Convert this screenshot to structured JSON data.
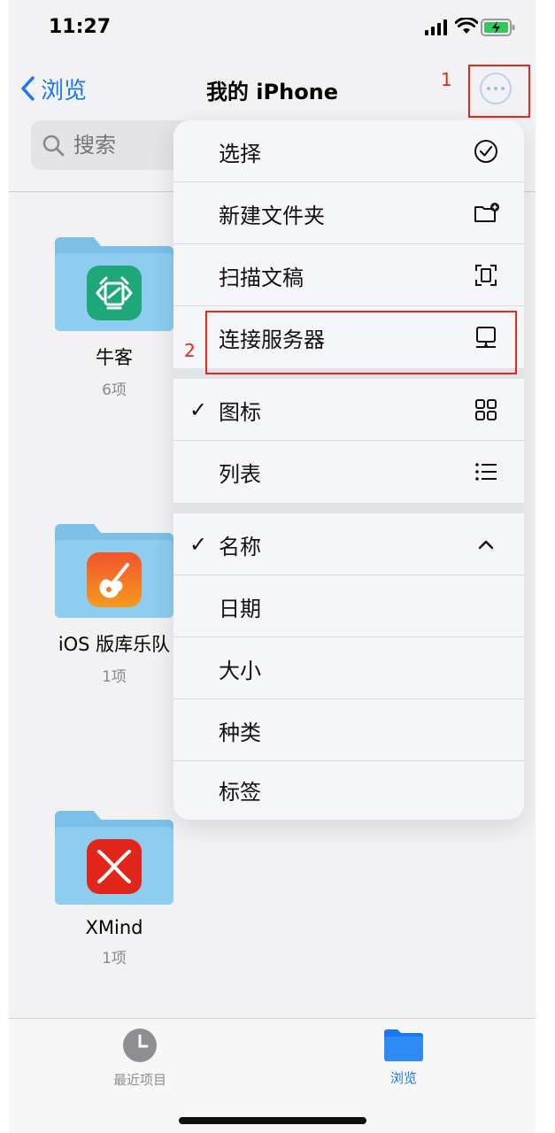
{
  "status": {
    "time": "11:27"
  },
  "nav": {
    "back_label": "浏览",
    "title": "我的 iPhone"
  },
  "annotations": {
    "box1_label": "1",
    "box2_label": "2"
  },
  "search": {
    "placeholder": "搜索"
  },
  "folders": [
    {
      "name": "牛客",
      "count": "6项",
      "icon": "nowcoder-app-icon"
    },
    {
      "name": "iOS 版库乐队",
      "count": "1项",
      "icon": "garageband-app-icon"
    },
    {
      "name": "XMind",
      "count": "1项",
      "icon": "xmind-app-icon"
    }
  ],
  "menu": {
    "select": "选择",
    "new_folder": "新建文件夹",
    "scan": "扫描文稿",
    "connect": "连接服务器",
    "icons": "图标",
    "list": "列表",
    "name": "名称",
    "date": "日期",
    "size": "大小",
    "kind": "种类",
    "tags": "标签",
    "checkmark": "✓"
  },
  "tabs": {
    "recent": "最近项目",
    "browse": "浏览"
  },
  "colors": {
    "accent": "#1a78f0",
    "annotation": "#e4281c",
    "folder": "#8fcdf0"
  }
}
